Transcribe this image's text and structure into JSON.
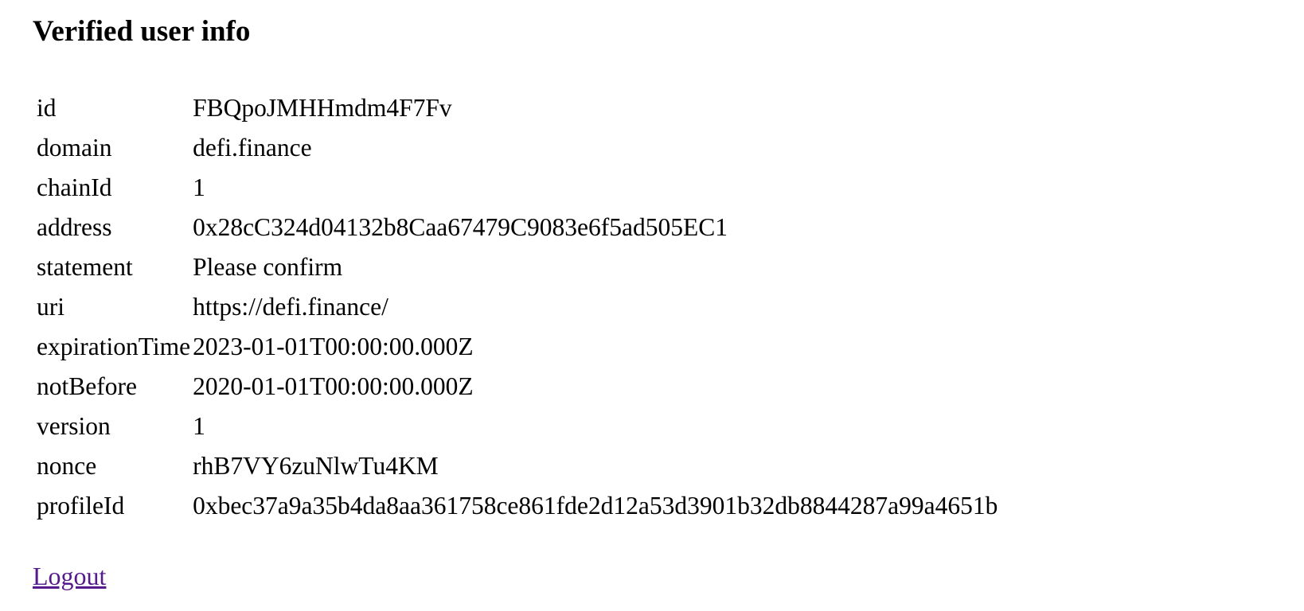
{
  "heading": "Verified user info",
  "rows": [
    {
      "key": "id",
      "value": "FBQpoJMHHmdm4F7Fv"
    },
    {
      "key": "domain",
      "value": "defi.finance"
    },
    {
      "key": "chainId",
      "value": "1"
    },
    {
      "key": "address",
      "value": "0x28cC324d04132b8Caa67479C9083e6f5ad505EC1"
    },
    {
      "key": "statement",
      "value": "Please confirm"
    },
    {
      "key": "uri",
      "value": "https://defi.finance/"
    },
    {
      "key": "expirationTime",
      "value": "2023-01-01T00:00:00.000Z"
    },
    {
      "key": "notBefore",
      "value": "2020-01-01T00:00:00.000Z"
    },
    {
      "key": "version",
      "value": "1"
    },
    {
      "key": "nonce",
      "value": "rhB7VY6zuNlwTu4KM"
    },
    {
      "key": "profileId",
      "value": "0xbec37a9a35b4da8aa361758ce861fde2d12a53d3901b32db8844287a99a4651b"
    }
  ],
  "logout_label": "Logout",
  "colors": {
    "link_visited": "#551A8B",
    "text": "#000000",
    "background": "#ffffff"
  }
}
